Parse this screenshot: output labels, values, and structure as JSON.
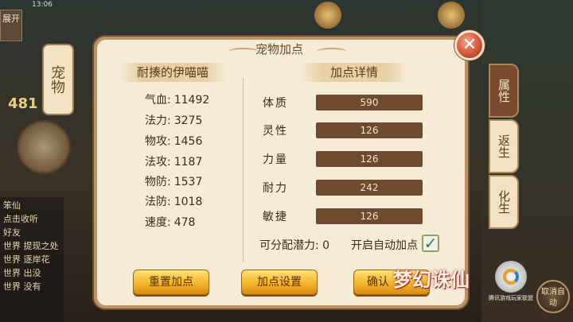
{
  "status_bar": {
    "time": "13:06"
  },
  "background": {
    "left_menu_label": "展开",
    "pet_tab_label": "宠物",
    "floating_number": "481",
    "chat_lines": [
      "笨仙",
      "点击收听",
      "好友",
      "世界 提现之处",
      "世界 逐岸花",
      "世界 出没",
      "世界 没有"
    ],
    "side_tabs": [
      "属性",
      "返生",
      "化生"
    ],
    "right_round_button": "取消自动"
  },
  "dialog": {
    "title": "宠物加点",
    "pet_name": "耐揍的伊喵喵",
    "details_header": "加点详情",
    "stats": [
      {
        "label": "气血:",
        "value": "11492"
      },
      {
        "label": "法力:",
        "value": "3275"
      },
      {
        "label": "物攻:",
        "value": "1456"
      },
      {
        "label": "法攻:",
        "value": "1187"
      },
      {
        "label": "物防:",
        "value": "1537"
      },
      {
        "label": "法防:",
        "value": "1018"
      },
      {
        "label": "速度:",
        "value": "478"
      }
    ],
    "attributes": [
      {
        "label": "体质",
        "value": "590"
      },
      {
        "label": "灵性",
        "value": "126"
      },
      {
        "label": "力量",
        "value": "126"
      },
      {
        "label": "耐力",
        "value": "242"
      },
      {
        "label": "敏捷",
        "value": "126"
      }
    ],
    "potential_label": "可分配潜力: 0",
    "auto_add_label": "开启自动加点",
    "auto_add_checked": true,
    "buttons": {
      "reset": "重置加点",
      "settings": "加点设置",
      "confirm": "确认"
    }
  },
  "watermark": {
    "logo_text": "梦幻诛仙",
    "badge_caption": "腾讯游戏玩家联盟"
  },
  "colors": {
    "panel_bg": "#f6ebd6",
    "bar_bg": "#6e4a2e",
    "button_gold": "#f3b52a",
    "close_red": "#d6553a",
    "check_green": "#1d8a3a"
  }
}
